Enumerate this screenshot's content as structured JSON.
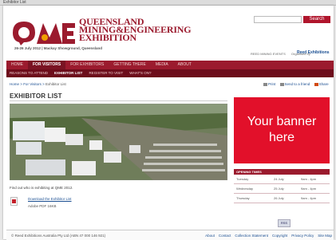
{
  "window": {
    "title": "Exhibitor List"
  },
  "header": {
    "logo_line1": "QUEENSLAND",
    "logo_line2": "MINING&ENGINEERING",
    "logo_line3": "EXHIBITION",
    "date_line": "26-26 July 2012 | Mackay Showground, Queensland",
    "search_label": "Search",
    "partner_text": "REED MINING EVENTS",
    "organiser_text": "Organised by",
    "reed_text": "Reed Exhibitions"
  },
  "nav": {
    "items": [
      "HOME",
      "FOR VISITORS",
      "FOR EXHIBITORS",
      "GETTING THERE",
      "MEDIA",
      "ABOUT"
    ],
    "active": "FOR VISITORS"
  },
  "subnav": {
    "items": [
      "REASONS TO ATTEND",
      "EXHIBITOR LIST",
      "REGISTER TO VISIT",
      "WHAT'S ON?"
    ],
    "active": "EXHIBITOR LIST"
  },
  "breadcrumb": {
    "home": "Home",
    "sep": ">",
    "parent": "For Visitors",
    "current": "Exhibitor List"
  },
  "tools": {
    "print": "Print",
    "send": "Send to a friend",
    "share": "Share"
  },
  "main": {
    "title": "EXHIBITOR LIST",
    "intro": "Find out who is exhibiting at QME 2012.",
    "download_label": "Download the Exhibitor List",
    "download_meta": "Adobe PDF 16KB"
  },
  "banner": {
    "text_line1": "Your banner",
    "text_line2": "here"
  },
  "hours": {
    "title": "OPENING TIMES",
    "rows": [
      {
        "day": "Tuesday",
        "date": "24 July",
        "time": "9am - 4pm"
      },
      {
        "day": "Wednesday",
        "date": "25 July",
        "time": "9am - 4pm"
      },
      {
        "day": "Thursday",
        "date": "26 July",
        "time": "9am - 4pm"
      }
    ]
  },
  "footer": {
    "copyright": "© Reed Exhibitions Australia Pty Ltd (ABN 47 000 146 921)",
    "links": [
      "About",
      "Contact",
      "Collection Statement",
      "Copyright",
      "Privacy Policy",
      "Site Map"
    ]
  },
  "colors": {
    "brand": "#9b1b2e",
    "banner": "#e2102a",
    "link": "#1a4e91"
  }
}
